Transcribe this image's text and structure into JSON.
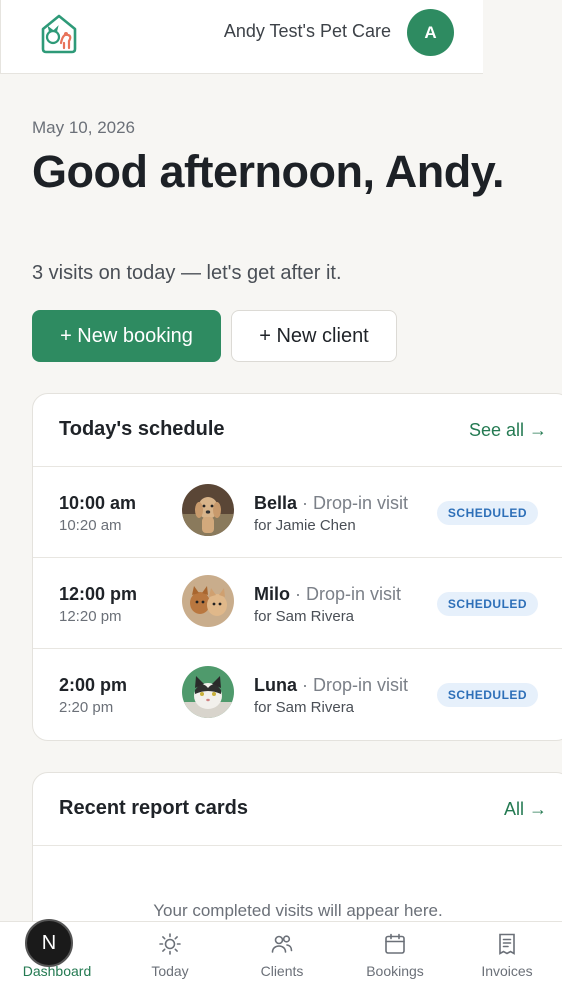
{
  "header": {
    "business_name": "Andy Test's Pet Care",
    "avatar_initial": "A",
    "logo_icon": "home-pet-logo-icon",
    "brand_color": "#2e8b61"
  },
  "greeting": {
    "date": "May 10, 2026",
    "title": "Good afternoon, Andy.",
    "subtitle": "3 visits on today — let's get after it."
  },
  "actions": {
    "new_booking": "+ New booking",
    "new_client": "+ New client"
  },
  "schedule": {
    "title": "Today's schedule",
    "see_all": "See all →",
    "visits": [
      {
        "start": "10:00 am",
        "end": "10:20 am",
        "pet": "Bella",
        "type": "· Drop-in visit",
        "client": "for Jamie Chen",
        "status": "SCHEDULED"
      },
      {
        "start": "12:00 pm",
        "end": "12:20 pm",
        "pet": "Milo",
        "type": "· Drop-in visit",
        "client": "for Sam Rivera",
        "status": "SCHEDULED"
      },
      {
        "start": "2:00 pm",
        "end": "2:20 pm",
        "pet": "Luna",
        "type": "· Drop-in visit",
        "client": "for Sam Rivera",
        "status": "SCHEDULED"
      }
    ]
  },
  "reports": {
    "title": "Recent report cards",
    "all_link": "All →",
    "empty": "Your completed visits will appear here."
  },
  "nav": {
    "items": [
      {
        "label": "Dashboard",
        "icon": "dashboard-icon",
        "active": true
      },
      {
        "label": "Today",
        "icon": "sun-icon"
      },
      {
        "label": "Clients",
        "icon": "users-icon"
      },
      {
        "label": "Bookings",
        "icon": "calendar-icon"
      },
      {
        "label": "Invoices",
        "icon": "receipt-icon"
      }
    ]
  },
  "dev_badge": "N"
}
